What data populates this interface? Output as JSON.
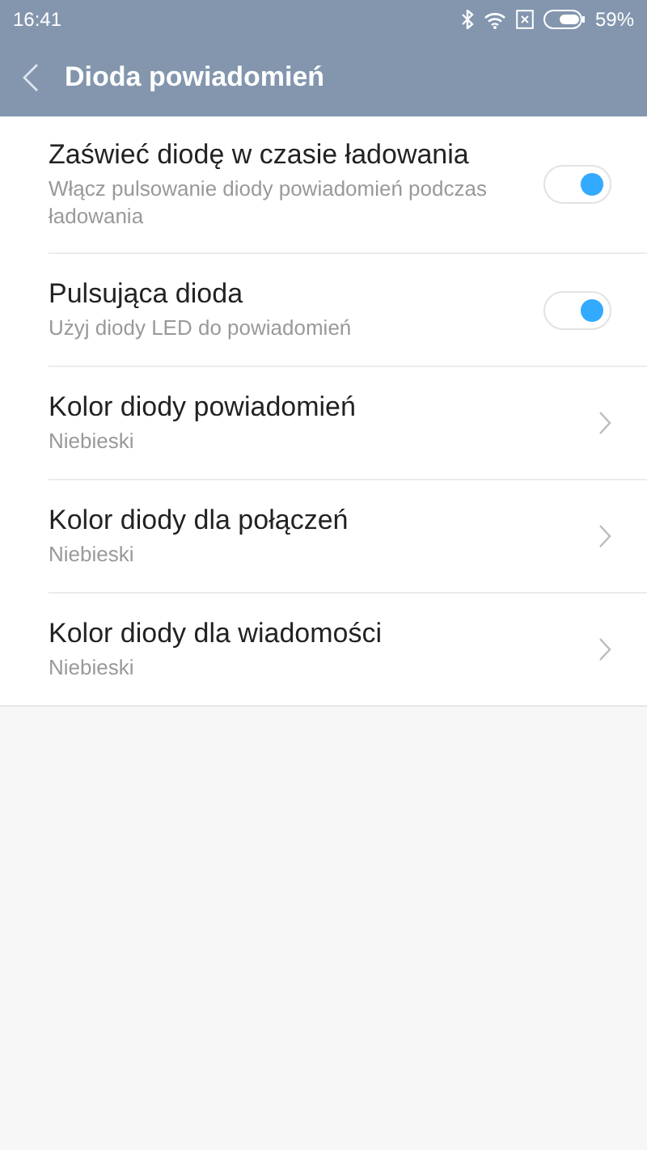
{
  "status_bar": {
    "time": "16:41",
    "battery": "59%"
  },
  "header": {
    "title": "Dioda powiadomień"
  },
  "settings": [
    {
      "kind": "toggle",
      "title": "Zaświeć diodę w czasie ładowania",
      "subtitle": "Włącz pulsowanie diody powiadomień podczas ładowania",
      "on": true
    },
    {
      "kind": "toggle",
      "title": "Pulsująca dioda",
      "subtitle": "Użyj diody LED do powiadomień",
      "on": true
    },
    {
      "kind": "link",
      "title": "Kolor diody powiadomień",
      "subtitle": "Niebieski"
    },
    {
      "kind": "link",
      "title": "Kolor diody dla połączeń",
      "subtitle": "Niebieski"
    },
    {
      "kind": "link",
      "title": "Kolor diody dla wiadomości",
      "subtitle": "Niebieski"
    }
  ]
}
